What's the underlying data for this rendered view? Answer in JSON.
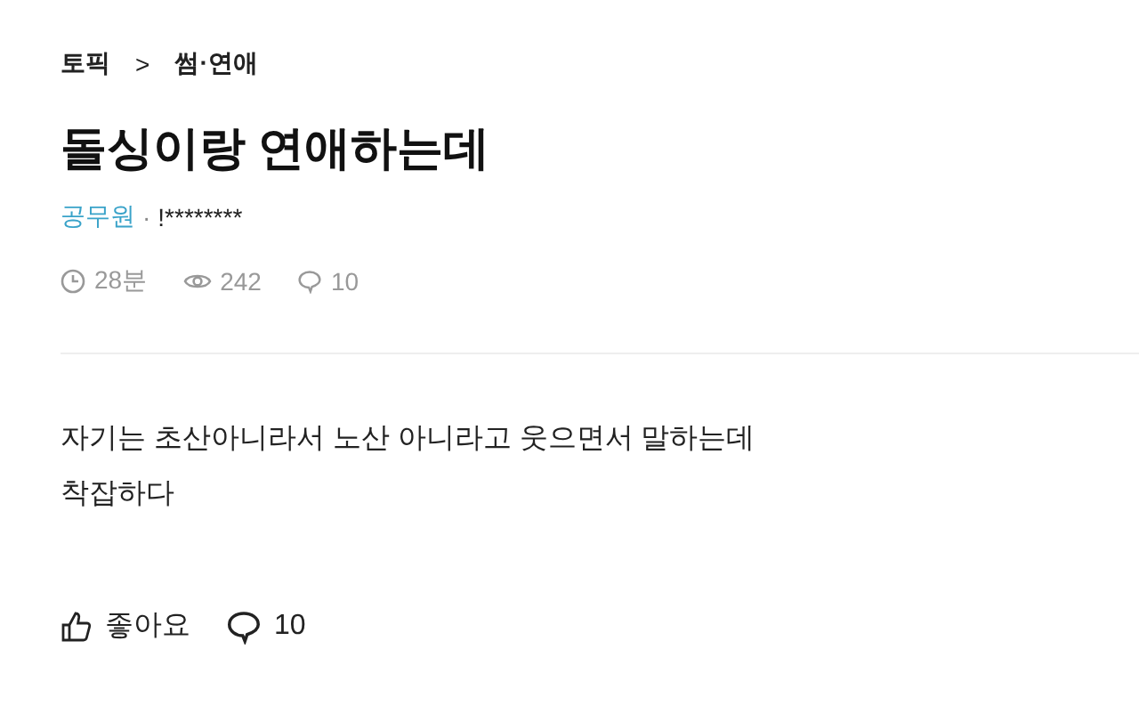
{
  "breadcrumb": {
    "root": "토픽",
    "separator": ">",
    "topic": "썸·연애"
  },
  "title": "돌싱이랑 연애하는데",
  "author": {
    "company": "공무원",
    "separator": "·",
    "nickname": "!********"
  },
  "stats": {
    "time": "28분",
    "views": "242",
    "comments": "10"
  },
  "body": [
    "자기는 초산아니라서 노산 아니라고 웃으면서 말하는데",
    "착잡하다"
  ],
  "actions": {
    "like": "좋아요",
    "comments": "10"
  }
}
